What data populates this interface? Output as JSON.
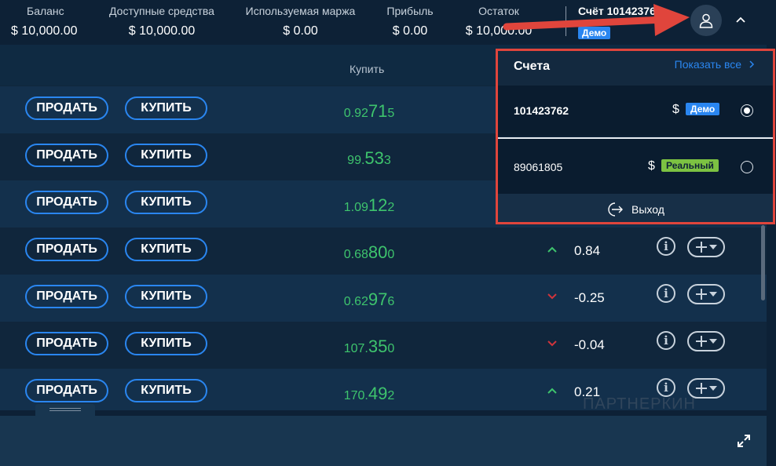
{
  "header": {
    "metrics": [
      {
        "label": "Баланс",
        "value": "$ 10,000.00"
      },
      {
        "label": "Доступные средства",
        "value": "$ 10,000.00"
      },
      {
        "label": "Используемая маржа",
        "value": "$ 0.00"
      },
      {
        "label": "Прибыль",
        "value": "$ 0.00"
      },
      {
        "label": "Остаток",
        "value": "$ 10,000.00"
      }
    ],
    "account_title": "Счёт 101423762",
    "account_badge": "Демо",
    "user_icon": "user-icon",
    "caret_icon": "chevron-up-icon"
  },
  "table": {
    "buy_header": "Купить",
    "sell_label": "ПРОДАТЬ",
    "buy_label": "КУПИТЬ",
    "rows": [
      {
        "price_small": "0.92",
        "price_big": "71",
        "price_tail": "5",
        "change": "",
        "direction": ""
      },
      {
        "price_small": "99.",
        "price_big": "53",
        "price_tail": "3",
        "change": "",
        "direction": ""
      },
      {
        "price_small": "1.09",
        "price_big": "12",
        "price_tail": "2",
        "change": "",
        "direction": ""
      },
      {
        "price_small": "0.68",
        "price_big": "80",
        "price_tail": "0",
        "change": "0.84",
        "direction": "up"
      },
      {
        "price_small": "0.62",
        "price_big": "97",
        "price_tail": "6",
        "change": "-0.25",
        "direction": "down"
      },
      {
        "price_small": "107.",
        "price_big": "35",
        "price_tail": "0",
        "change": "-0.04",
        "direction": "down"
      },
      {
        "price_small": "170.",
        "price_big": "49",
        "price_tail": "2",
        "change": "0.21",
        "direction": "up"
      }
    ]
  },
  "colors": {
    "accent": "#2a86f0",
    "price_green": "#3ec46d",
    "down_red": "#d0343c",
    "annotation_red": "#e0453c",
    "real_badge": "#7cc242"
  },
  "dropdown": {
    "title": "Счета",
    "show_all": "Показать все",
    "accounts": [
      {
        "id": "101423762",
        "currency": "$",
        "badge": "Демо",
        "selected": true
      },
      {
        "id": "89061805",
        "currency": "$",
        "badge": "Реальный",
        "selected": false
      }
    ],
    "logout": "Выход"
  },
  "watermark": "ПАРТНЕРКИН"
}
